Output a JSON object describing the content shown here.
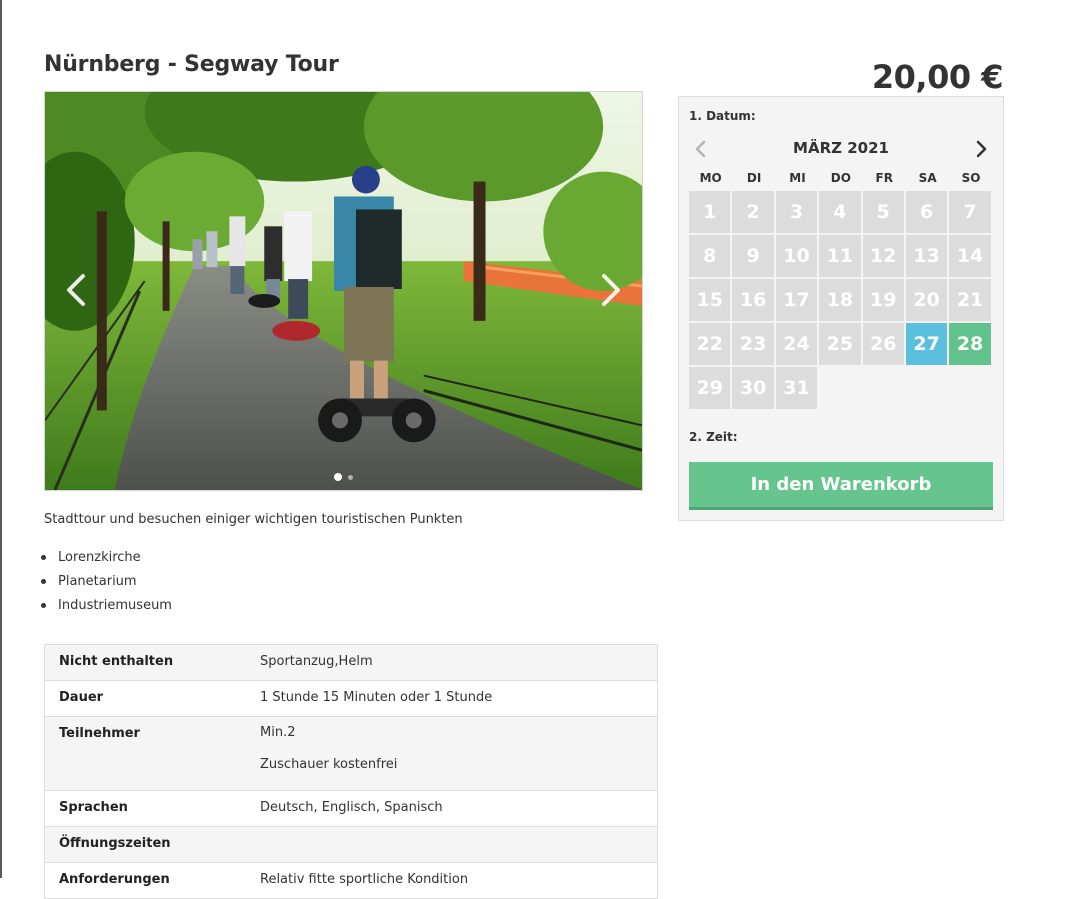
{
  "product": {
    "title": "Nürnberg - Segway Tour",
    "price": "20,00 €",
    "description": "Stadttour und besuchen einiger wichtigen touristischen Punkten",
    "features": [
      "Lorenzkirche",
      "Planetarium",
      "Industriemuseum"
    ]
  },
  "slider": {
    "prev_icon": "chevron-left-icon",
    "next_icon": "chevron-right-icon",
    "slide_count": 2,
    "active_slide": 1
  },
  "details": {
    "rows": [
      {
        "label": "Nicht enthalten",
        "values": [
          "Sportanzug,Helm"
        ]
      },
      {
        "label": "Dauer",
        "values": [
          "1 Stunde 15 Minuten oder 1 Stunde"
        ]
      },
      {
        "label": "Teilnehmer",
        "values": [
          "Min.2",
          "Zuschauer kostenfrei"
        ]
      },
      {
        "label": "Sprachen",
        "values": [
          "Deutsch, Englisch, Spanisch"
        ]
      },
      {
        "label": "Öffnungszeiten",
        "values": [
          ""
        ]
      },
      {
        "label": "Anforderungen",
        "values": [
          "Relativ fitte sportliche Kondition"
        ]
      }
    ]
  },
  "booking": {
    "step_date": "1. Datum:",
    "step_time": "2. Zeit:",
    "month": "MÄRZ 2021",
    "weekdays": [
      "MO",
      "DI",
      "MI",
      "DO",
      "FR",
      "SA",
      "SO"
    ],
    "weeks": [
      [
        "1",
        "2",
        "3",
        "4",
        "5",
        "6",
        "7"
      ],
      [
        "8",
        "9",
        "10",
        "11",
        "12",
        "13",
        "14"
      ],
      [
        "15",
        "16",
        "17",
        "18",
        "19",
        "20",
        "21"
      ],
      [
        "22",
        "23",
        "24",
        "25",
        "26",
        "27",
        "28"
      ],
      [
        "29",
        "30",
        "31",
        "",
        "",
        "",
        ""
      ]
    ],
    "available_days": {
      "27": "blue",
      "28": "green"
    },
    "cart_button": "In den Warenkorb",
    "colors": {
      "unavailable": "#dcdcdc",
      "available_blue": "#5bc0de",
      "available_green": "#62c28b",
      "button": "#66c58c"
    }
  }
}
